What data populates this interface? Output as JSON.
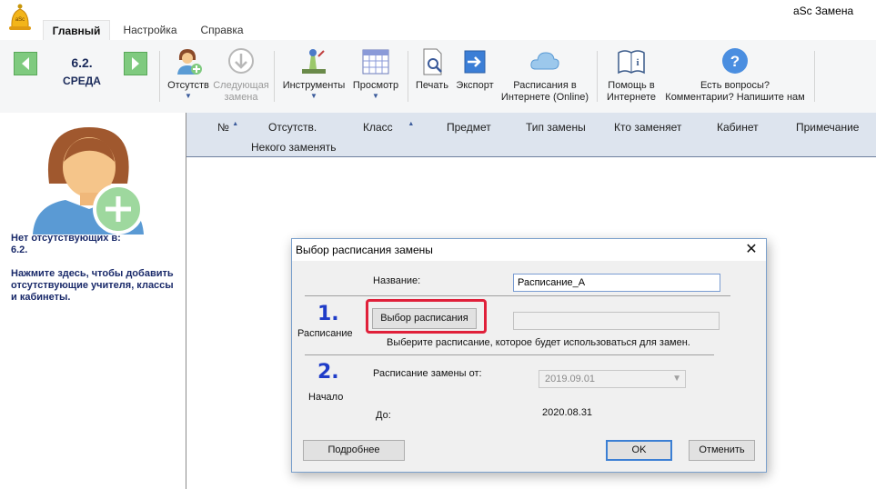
{
  "app": {
    "title": "aSc Замена",
    "logo_text": "aSc"
  },
  "tabs": [
    {
      "label": "Главный",
      "active": true
    },
    {
      "label": "Настройка",
      "active": false
    },
    {
      "label": "Справка",
      "active": false
    }
  ],
  "date": {
    "number": "6.2.",
    "day": "СРЕДА"
  },
  "ribbon": {
    "absent": "Отсутств",
    "next_line1": "Следующая",
    "next_line2": "замена",
    "tools": "Инструменты",
    "view": "Просмотр",
    "print": "Печать",
    "export": "Экспорт",
    "online_line1": "Расписания в",
    "online_line2": "Интернете (Online)",
    "help_line1": "Помощь в",
    "help_line2": "Интернете",
    "questions_line1": "Есть вопросы?",
    "questions_line2": "Комментарии? Напишите нам"
  },
  "left_panel": {
    "line1": "Нет отсутствующих в:",
    "line2": "6.2.",
    "hint": "Нажмите здесь, чтобы добавить отсутствующие учителя, классы и кабинеты."
  },
  "grid": {
    "columns": [
      "№",
      "Отсутств.",
      "Класс",
      "Предмет",
      "Тип замены",
      "Кто заменяет",
      "Кабинет",
      "Примечание"
    ],
    "sub_header": "Некого заменять"
  },
  "dialog": {
    "title": "Выбор расписания замены",
    "name_label": "Название:",
    "name_value": "Расписание_А",
    "step1": "1.",
    "schedule_label": "Расписание",
    "choose_button": "Выбор расписания",
    "choose_hint": "Выберите расписание, которое будет использоваться для замен.",
    "step2": "2.",
    "start_label": "Начало",
    "from_label": "Расписание замены от:",
    "from_value": "2019.09.01",
    "to_label": "До:",
    "to_value": "2020.08.31",
    "more_button": "Подробнее",
    "ok_button": "OK",
    "cancel_button": "Отменить"
  },
  "colors": {
    "highlight": "#e0203a",
    "step_number": "#1f3cc8",
    "grid_header": "#dde4ee",
    "accent_green": "#7fca7f"
  }
}
